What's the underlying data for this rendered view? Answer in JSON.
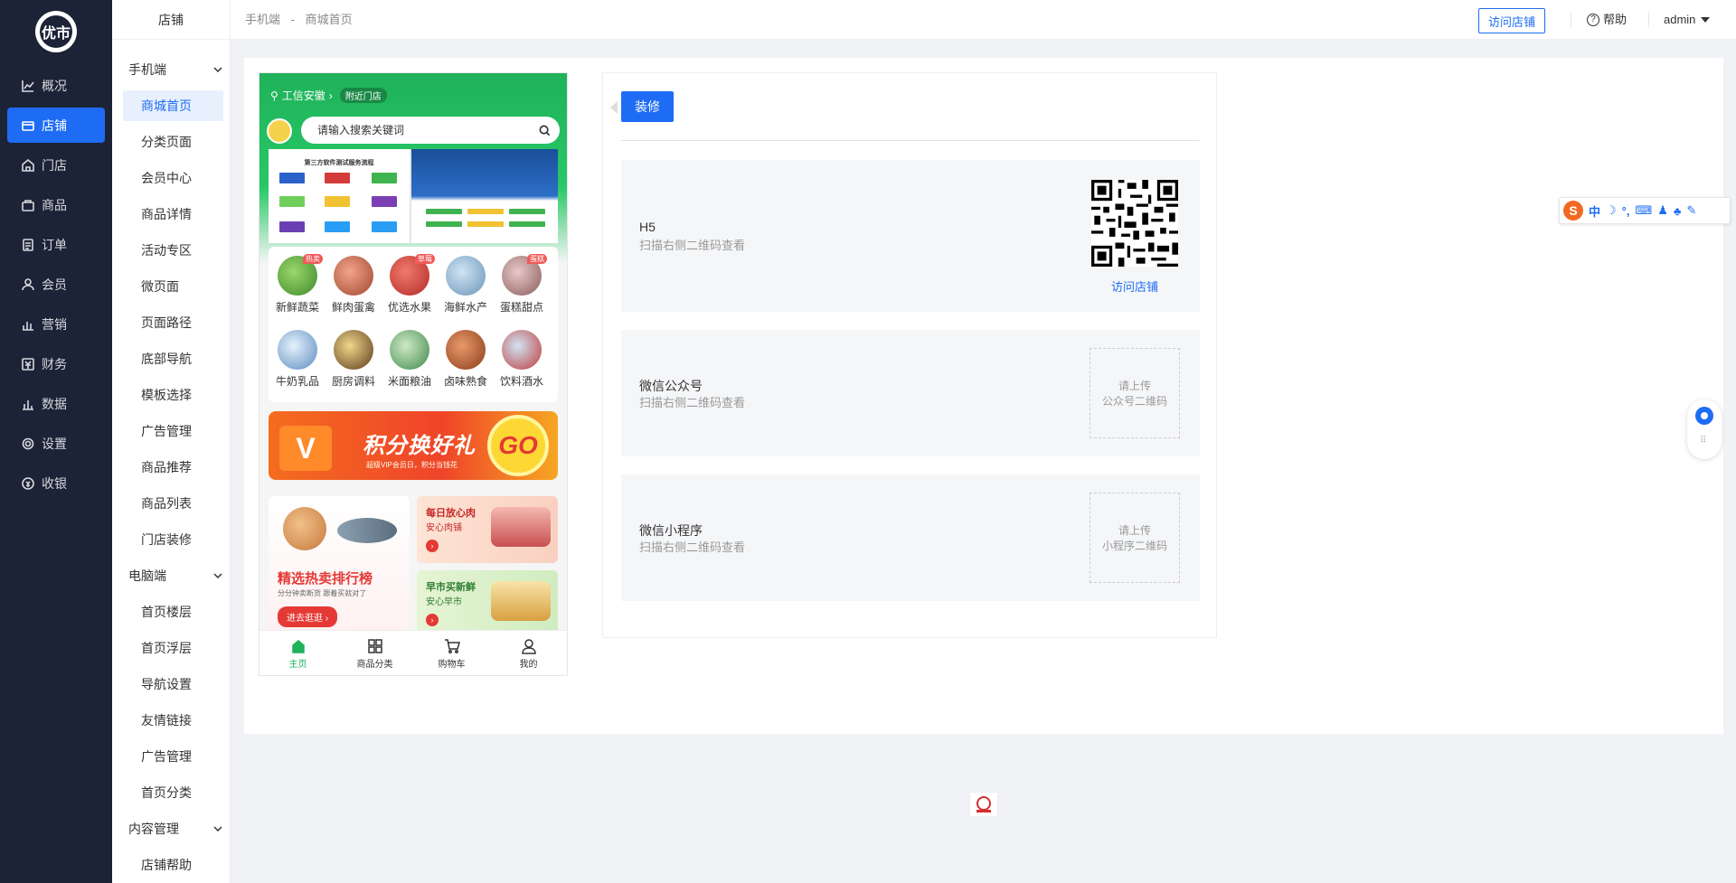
{
  "nav": {
    "logo_text": "优市",
    "items": [
      {
        "label": "概况",
        "icon": "chart-icon"
      },
      {
        "label": "店铺",
        "icon": "store-icon"
      },
      {
        "label": "门店",
        "icon": "shop-icon"
      },
      {
        "label": "商品",
        "icon": "bag-icon"
      },
      {
        "label": "订单",
        "icon": "order-icon"
      },
      {
        "label": "会员",
        "icon": "user-icon"
      },
      {
        "label": "营销",
        "icon": "marketing-icon"
      },
      {
        "label": "财务",
        "icon": "finance-icon"
      },
      {
        "label": "数据",
        "icon": "data-icon"
      },
      {
        "label": "设置",
        "icon": "gear-icon"
      },
      {
        "label": "收银",
        "icon": "cashier-icon"
      }
    ]
  },
  "subnav": {
    "title": "店铺",
    "group_mobile": "手机端",
    "mobile_items": [
      "商城首页",
      "分类页面",
      "会员中心",
      "商品详情",
      "活动专区",
      "微页面",
      "页面路径",
      "底部导航",
      "模板选择",
      "广告管理",
      "商品推荐",
      "商品列表",
      "门店装修"
    ],
    "group_pc": "电脑端",
    "pc_items": [
      "首页楼层",
      "首页浮层",
      "导航设置",
      "友情链接",
      "广告管理",
      "首页分类"
    ],
    "group_content": "内容管理",
    "content_items": [
      "店铺帮助"
    ]
  },
  "topbar": {
    "crumb_1": "手机端",
    "crumb_sep": "-",
    "crumb_2": "商城首页",
    "visit_store": "访问店铺",
    "help": "帮助",
    "help_icon": "?",
    "user": "admin"
  },
  "phone": {
    "location": "工信安徽",
    "nearby": "附近门店",
    "search_placeholder": "请输入搜索关键词",
    "banner_title": "第三方软件测试服务流程",
    "categories": [
      {
        "label": "新鲜蔬菜",
        "tag": "热卖"
      },
      {
        "label": "鲜肉蛋禽",
        "tag": ""
      },
      {
        "label": "优选水果",
        "tag": "草莓"
      },
      {
        "label": "海鲜水产",
        "tag": ""
      },
      {
        "label": "蛋糕甜点",
        "tag": "蛋糕"
      },
      {
        "label": "牛奶乳品",
        "tag": ""
      },
      {
        "label": "厨房调料",
        "tag": ""
      },
      {
        "label": "米面粮油",
        "tag": ""
      },
      {
        "label": "卤味熟食",
        "tag": ""
      },
      {
        "label": "饮料酒水",
        "tag": ""
      }
    ],
    "promo_title": "积分换好礼",
    "promo_sub": "超级VIP会员日，积分当钱花",
    "promo_go": "GO",
    "promo_v": "V",
    "hot_title": "精选热卖排行榜",
    "hot_sub": "分分钟卖断货 跟着买就对了",
    "hot_btn": "进去逛逛",
    "card1_title": "每日放心肉",
    "card1_sub": "安心肉铺",
    "card2_title": "早市买新鲜",
    "card2_sub": "安心早市",
    "tabs": [
      {
        "label": "主页",
        "icon": "home-icon"
      },
      {
        "label": "商品分类",
        "icon": "grid-icon"
      },
      {
        "label": "购物车",
        "icon": "cart-icon"
      },
      {
        "label": "我的",
        "icon": "person-icon"
      }
    ]
  },
  "panel": {
    "decorate_btn": "装修",
    "h5_title": "H5",
    "h5_desc": "扫描右侧二维码查看",
    "h5_link": "访问店铺",
    "wx_title": "微信公众号",
    "wx_desc": "扫描右侧二维码查看",
    "wx_upload_1": "请上传",
    "wx_upload_2": "公众号二维码",
    "mp_title": "微信小程序",
    "mp_desc": "扫描右侧二维码查看",
    "mp_upload_1": "请上传",
    "mp_upload_2": "小程序二维码"
  },
  "ime": {
    "label": "中",
    "brand": "S"
  },
  "colors": {
    "primary": "#1e6cf4",
    "sidebar": "#1d2336",
    "green": "#1fb25a"
  }
}
